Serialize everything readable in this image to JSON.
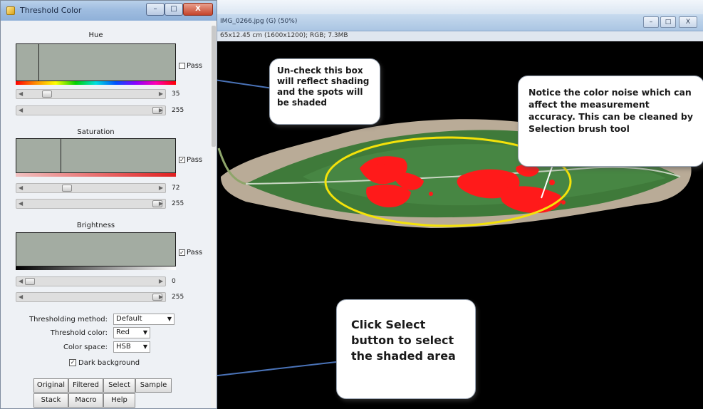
{
  "dialog": {
    "title": "Threshold Color",
    "hue": {
      "label": "Hue",
      "pass_label": "Pass",
      "pass_checked": false,
      "slider_min": "35",
      "slider_max": "255"
    },
    "saturation": {
      "label": "Saturation",
      "pass_label": "Pass",
      "pass_checked": true,
      "slider_min": "72",
      "slider_max": "255"
    },
    "brightness": {
      "label": "Brightness",
      "pass_label": "Pass",
      "pass_checked": true,
      "slider_min": "0",
      "slider_max": "255"
    },
    "thresholding_method": {
      "label": "Thresholding method:",
      "value": "Default"
    },
    "threshold_color": {
      "label": "Threshold color:",
      "value": "Red"
    },
    "color_space": {
      "label": "Color space:",
      "value": "HSB"
    },
    "dark_background": {
      "label": "Dark background",
      "checked": true
    },
    "buttons_row1": [
      "Original",
      "Filtered",
      "Select",
      "Sample"
    ],
    "buttons_row2": [
      "Stack",
      "Macro",
      "Help"
    ]
  },
  "image_window": {
    "title": "IMG_0266.jpg (G) (50%)",
    "info": "65x12.45 cm (1600x1200); RGB; 7.3MB"
  },
  "callouts": {
    "uncheck": "Un-check this box will reflect shading and the spots will be shaded",
    "noise": "Notice the color noise which can affect the measurement accuracy. This can be cleaned by Selection brush tool",
    "select": "Click Select button to select the shaded area"
  },
  "colors": {
    "leaf_green": "#3f7a3a",
    "spot_red": "#ff1a1a",
    "ellipse_yellow": "#f4e20a",
    "callout_line": "#4a73b8"
  }
}
